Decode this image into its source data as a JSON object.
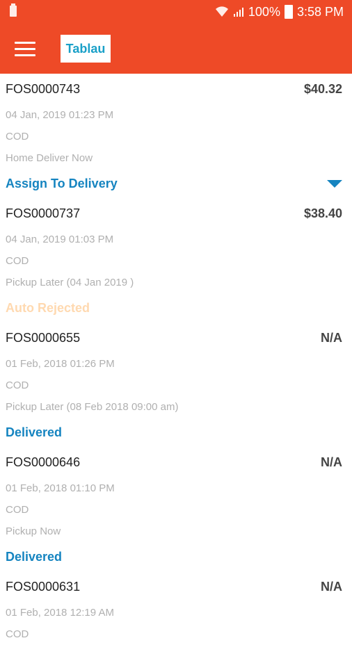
{
  "status_bar": {
    "battery_percent": "100%",
    "time": "3:58 PM"
  },
  "app_bar": {
    "logo_text": "Tablau"
  },
  "orders": [
    {
      "id": "FOS0000743",
      "amount": "$40.32",
      "datetime": "04 Jan, 2019 01:23 PM",
      "payment": "COD",
      "delivery": "Home Deliver Now",
      "status": "Assign To Delivery",
      "status_color": "#1584c0",
      "has_dropdown": true
    },
    {
      "id": "FOS0000737",
      "amount": "$38.40",
      "datetime": "04 Jan, 2019 01:03 PM",
      "payment": "COD",
      "delivery": "Pickup Later (04 Jan 2019 )",
      "status": "Auto Rejected",
      "status_color": "#ffd9b0"
    },
    {
      "id": "FOS0000655",
      "amount": "N/A",
      "datetime": "01 Feb, 2018 01:26 PM",
      "payment": "COD",
      "delivery": "Pickup Later (08 Feb 2018 09:00 am)",
      "status": "Delivered",
      "status_color": "#1584c0"
    },
    {
      "id": "FOS0000646",
      "amount": "N/A",
      "datetime": "01 Feb, 2018 01:10 PM",
      "payment": "COD",
      "delivery": "Pickup Now",
      "status": "Delivered",
      "status_color": "#1584c0"
    },
    {
      "id": "FOS0000631",
      "amount": "N/A",
      "datetime": "01 Feb, 2018 12:19 AM",
      "payment": "COD"
    }
  ],
  "colors": {
    "primary": "#ee4a27",
    "status_blue": "#1584c0",
    "status_rejected": "#ffd9b0",
    "meta_grey": "#b0b0b0"
  }
}
